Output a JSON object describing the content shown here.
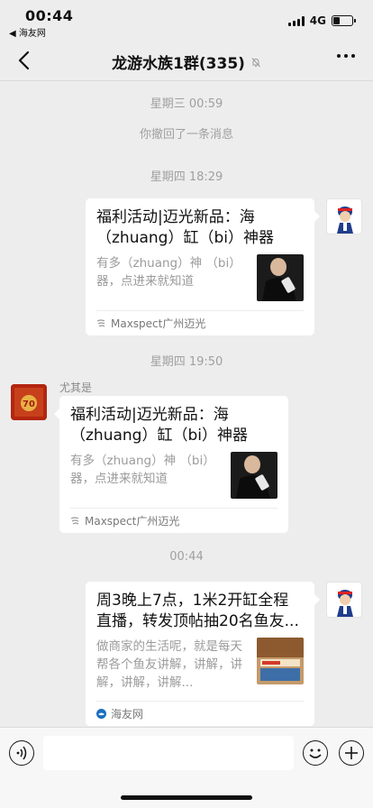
{
  "status_bar": {
    "time": "00:44",
    "back_app": "◀ 海友网",
    "network": "4G",
    "battery_level": 0.35
  },
  "header": {
    "title": "龙游水族1群(335)",
    "muted": true
  },
  "messages": {
    "sys1": "星期三 00:59",
    "recall": "你撤回了一条消息",
    "sys2": "星期四 18:29",
    "card1": {
      "title": "福利活动|迈光新品：海（zhuang）缸（bi）神器",
      "desc": "有多（zhuang）神 （bi）器，点进来就知道",
      "source": "Maxspect广州迈光"
    },
    "sys3": "星期四 19:50",
    "sender2": "尤其是",
    "card2": {
      "title": "福利活动|迈光新品：海（zhuang）缸（bi）神器",
      "desc": "有多（zhuang）神 （bi）器，点进来就知道",
      "source": "Maxspect广州迈光"
    },
    "sys4": "00:44",
    "card3": {
      "title": "周3晚上7点，1米2开缸全程直播，转发顶帖抽20名鱼友...",
      "desc": "做商家的生活呢，就是每天帮各个鱼友讲解，讲解，讲解，讲解，讲解...",
      "source": "海友网"
    }
  },
  "colors": {
    "background": "#ededed",
    "bubble": "#ffffff",
    "system_text": "#a0a0a0"
  }
}
